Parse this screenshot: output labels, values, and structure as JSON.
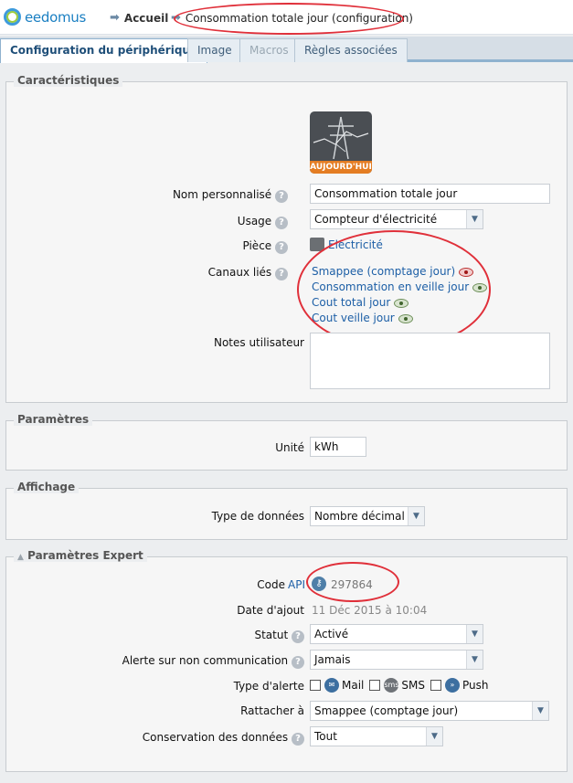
{
  "header": {
    "logo_text": "eedomus",
    "breadcrumb_home": "Accueil",
    "breadcrumb_current": "Consommation totale jour (configuration)"
  },
  "tabs": [
    {
      "label": "Configuration du périphérique",
      "state": "active"
    },
    {
      "label": "Image",
      "state": "normal"
    },
    {
      "label": "Macros",
      "state": "disabled"
    },
    {
      "label": "Règles associées",
      "state": "normal"
    }
  ],
  "characteristics": {
    "legend": "Caractéristiques",
    "device_image_caption": "AUJOURD'HUI",
    "custom_name_label": "Nom personnalisé",
    "custom_name_value": "Consommation totale jour",
    "usage_label": "Usage",
    "usage_value": "Compteur d'électricité",
    "room_label": "Pièce",
    "room_value": "Electricité",
    "linked_channels_label": "Canaux liés",
    "linked_channels": [
      {
        "name": "Smappee (comptage jour)",
        "eye": "red"
      },
      {
        "name": "Consommation en veille jour",
        "eye": "green"
      },
      {
        "name": "Cout total jour",
        "eye": "green"
      },
      {
        "name": "Cout veille jour",
        "eye": "green"
      }
    ],
    "notes_label": "Notes utilisateur",
    "notes_value": ""
  },
  "parameters": {
    "legend": "Paramètres",
    "unit_label": "Unité",
    "unit_value": "kWh"
  },
  "display": {
    "legend": "Affichage",
    "data_type_label": "Type de données",
    "data_type_value": "Nombre décimal"
  },
  "expert": {
    "legend": "Paramètres Expert",
    "code_label": "Code",
    "api_link": "API",
    "code_value": "297864",
    "date_added_label": "Date d'ajout",
    "date_added_value": "11 Déc 2015 à 10:04",
    "status_label": "Statut",
    "status_value": "Activé",
    "alert_label": "Alerte sur non communication",
    "alert_value": "Jamais",
    "alert_type_label": "Type d'alerte",
    "alert_types": [
      "Mail",
      "SMS",
      "Push"
    ],
    "attach_label": "Rattacher à",
    "attach_value": "Smappee (comptage jour)",
    "retention_label": "Conservation des données",
    "retention_value": "Tout"
  },
  "colors": {
    "annotation_red": "#e0303a",
    "link_blue": "#1d5fa6"
  }
}
